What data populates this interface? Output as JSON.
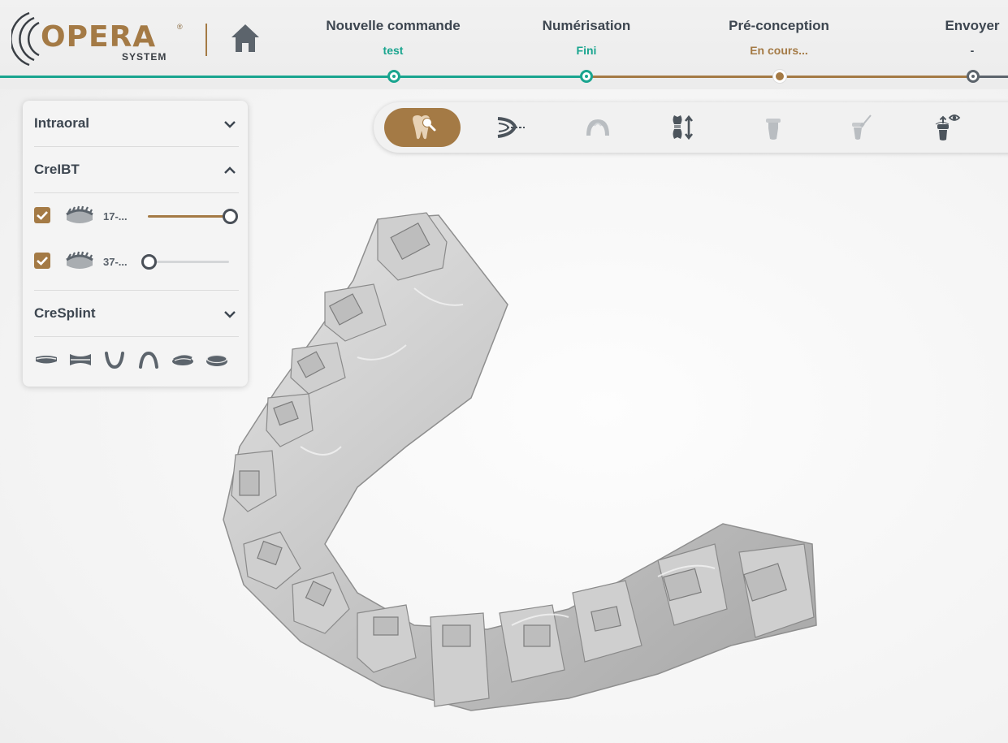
{
  "app": {
    "logo_text": "OPERA",
    "logo_registered": "®",
    "logo_subtext": "SYSTEM"
  },
  "header": {
    "home_icon": "home-icon",
    "steps": [
      {
        "title": "Nouvelle commande",
        "status": "test",
        "state": "done"
      },
      {
        "title": "Numérisation",
        "status": "Fini",
        "state": "done"
      },
      {
        "title": "Pré-conception",
        "status": "En cours...",
        "state": "current"
      },
      {
        "title": "Envoyer",
        "status": "-",
        "state": "pending"
      }
    ]
  },
  "panel": {
    "sections": [
      {
        "title": "Intraoral",
        "expanded": false
      },
      {
        "title": "CreIBT",
        "expanded": true
      },
      {
        "title": "CreSplint",
        "expanded": false
      }
    ],
    "models": [
      {
        "label": "17-...",
        "checked": true,
        "opacity": 1.0
      },
      {
        "label": "37-...",
        "checked": true,
        "opacity": 0.0
      }
    ],
    "splint_shapes": [
      "flat-splint-icon",
      "hourglass-splint-icon",
      "u-arch-icon",
      "n-arch-icon",
      "tilted-disc-icon",
      "disc-icon"
    ]
  },
  "toolbar": {
    "tools": [
      {
        "icon": "tooth-inspect-icon",
        "active": true
      },
      {
        "icon": "arch-path-icon",
        "active": false
      },
      {
        "icon": "arch-gray-icon",
        "active": false
      },
      {
        "icon": "tooth-move-icon",
        "active": false
      },
      {
        "icon": "bracket-gray-icon",
        "active": false
      },
      {
        "icon": "bracket-brush-icon",
        "active": false
      },
      {
        "icon": "bracket-view-icon",
        "active": false
      }
    ]
  },
  "colors": {
    "brand_gold": "#a47a45",
    "accent_teal": "#1aa58f",
    "text_dark": "#3d4650",
    "icon_gray": "#5c646c",
    "icon_disabled": "#b9bdc1"
  }
}
